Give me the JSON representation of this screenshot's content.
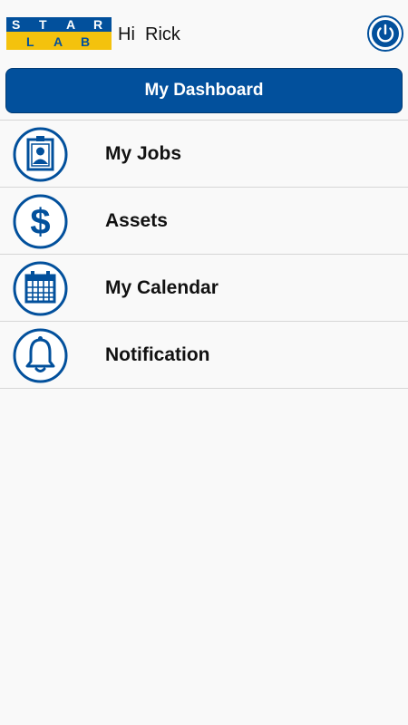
{
  "header": {
    "logo_text_top": "STAR",
    "logo_text_bottom": "LAB",
    "greeting": "Hi  Rick",
    "power_icon": "power-icon"
  },
  "dashboard_button": {
    "label": "My Dashboard"
  },
  "menu": {
    "items": [
      {
        "label": "My Jobs",
        "icon": "id-badge-icon"
      },
      {
        "label": "Assets",
        "icon": "dollar-icon"
      },
      {
        "label": "My Calendar",
        "icon": "calendar-icon"
      },
      {
        "label": "Notification",
        "icon": "bell-icon"
      }
    ]
  },
  "colors": {
    "brand_blue": "#02509c",
    "logo_yellow": "#f4c20d",
    "background": "#f9f9f9",
    "divider": "#d6d6d6"
  }
}
